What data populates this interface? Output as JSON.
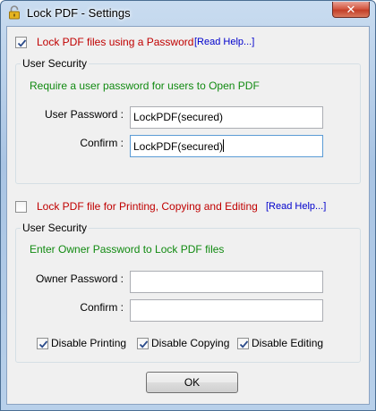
{
  "window": {
    "title": "Lock PDF - Settings",
    "close_glyph": "✕"
  },
  "open_section": {
    "checkbox_checked": true,
    "label": "Lock PDF files using a Password",
    "help_link": "[Read Help...]",
    "group_title": "User Security",
    "note": "Require a user password for users to Open PDF",
    "user_password_label": "User Password :",
    "user_password_value": "LockPDF(secured)",
    "confirm_label": "Confirm :",
    "confirm_value": "LockPDF(secured)"
  },
  "edit_section": {
    "checkbox_checked": false,
    "label": "Lock PDF file for Printing, Copying and Editing",
    "help_link": "[Read Help...]",
    "group_title": "User Security",
    "note": "Enter Owner Password to Lock PDF files",
    "owner_password_label": "Owner Password :",
    "owner_password_value": "",
    "confirm_label": "Confirm :",
    "confirm_value": "",
    "options": [
      {
        "label": "Disable Printing",
        "checked": true
      },
      {
        "label": "Disable Copying",
        "checked": true
      },
      {
        "label": "Disable Editing",
        "checked": true
      }
    ]
  },
  "ok_label": "OK",
  "icons": {
    "window": "padlock-icon",
    "close": "close-icon",
    "check": "checkmark-icon"
  },
  "colors": {
    "section_label": "#c00000",
    "link": "#0000cc",
    "note": "#118a11"
  }
}
